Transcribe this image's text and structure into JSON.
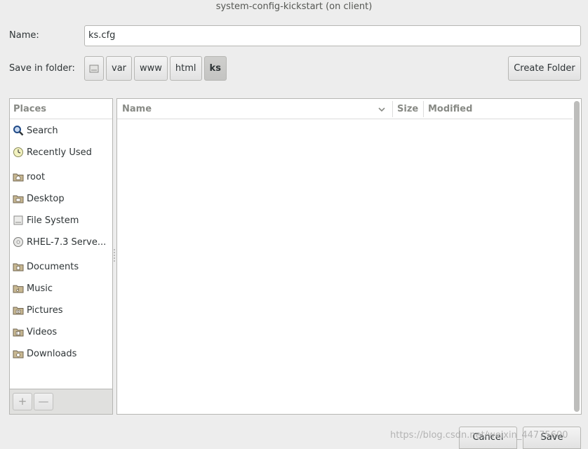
{
  "window": {
    "title": "system-config-kickstart (on client)"
  },
  "form": {
    "name_label": "Name:",
    "name_value": "ks.cfg",
    "folder_label": "Save in folder:"
  },
  "path_bar": {
    "segments": [
      "var",
      "www",
      "html",
      "ks"
    ],
    "active": "ks"
  },
  "create_folder_label": "Create Folder",
  "places": {
    "header": "Places",
    "items": [
      {
        "label": "Search",
        "icon": "search-icon"
      },
      {
        "label": "Recently Used",
        "icon": "recent-icon"
      },
      {
        "label": "root",
        "icon": "home-folder-icon"
      },
      {
        "label": "Desktop",
        "icon": "desktop-folder-icon"
      },
      {
        "label": "File System",
        "icon": "drive-icon"
      },
      {
        "label": "RHEL-7.3 Serve...",
        "icon": "optical-disc-icon"
      },
      {
        "label": "Documents",
        "icon": "documents-folder-icon"
      },
      {
        "label": "Music",
        "icon": "music-folder-icon"
      },
      {
        "label": "Pictures",
        "icon": "pictures-folder-icon"
      },
      {
        "label": "Videos",
        "icon": "videos-folder-icon"
      },
      {
        "label": "Downloads",
        "icon": "downloads-folder-icon"
      }
    ],
    "add_label": "+",
    "remove_label": "—"
  },
  "file_list": {
    "columns": {
      "name": "Name",
      "size": "Size",
      "modified": "Modified"
    }
  },
  "buttons": {
    "cancel": "Cancel",
    "save": "Save"
  },
  "watermark": "https://blog.csdn.net/weixin_44775600"
}
